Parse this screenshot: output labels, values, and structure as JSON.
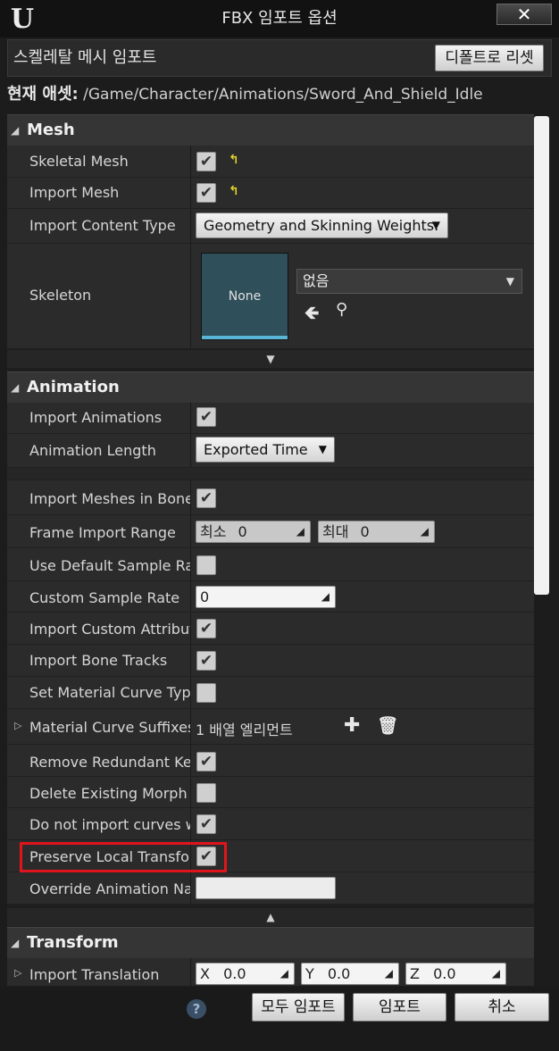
{
  "window": {
    "title": "FBX 임포트 옵션",
    "close_label": "✕",
    "logo": "U"
  },
  "topbar": {
    "label": "스켈레탈 메시 임포트",
    "reset_label": "디폴트로 리셋"
  },
  "asset": {
    "label": "현재 애셋:",
    "path": "/Game/Character/Animations/Sword_And_Shield_Idle"
  },
  "mesh": {
    "title": "Mesh",
    "skeletal_mesh_label": "Skeletal Mesh",
    "import_mesh_label": "Import Mesh",
    "import_content_type_label": "Import Content Type",
    "import_content_type_value": "Geometry and Skinning Weights.",
    "skeleton_label": "Skeleton",
    "skeleton_thumb": "None",
    "skeleton_value": "없음"
  },
  "animation": {
    "title": "Animation",
    "import_animations_label": "Import Animations",
    "animation_length_label": "Animation Length",
    "animation_length_value": "Exported Time",
    "import_meshes_in_bone_label": "Import Meshes in Bone",
    "frame_import_range_label": "Frame Import Range",
    "range_min_label": "최소",
    "range_min_value": "0",
    "range_max_label": "최대",
    "range_max_value": "0",
    "use_default_sample_rate_label": "Use Default Sample Rat",
    "custom_sample_rate_label": "Custom Sample Rate",
    "custom_sample_rate_value": "0",
    "import_custom_attribute_label": "Import Custom Attribute",
    "import_bone_tracks_label": "Import Bone Tracks",
    "set_material_curve_type_label": "Set Material Curve Type",
    "material_curve_suffixes_label": "Material Curve Suffixes",
    "material_curve_suffixes_value": "1 배열 엘리먼트",
    "remove_redundant_keys_label": "Remove Redundant Key",
    "delete_existing_morph_label": "Delete Existing Morph T",
    "do_not_import_curves_label": "Do not import curves wi",
    "preserve_local_transform_label": "Preserve Local Transfor",
    "override_animation_name_label": "Override Animation Nar"
  },
  "transform": {
    "title": "Transform",
    "import_translation_label": "Import Translation",
    "x_label": "X",
    "x_value": "0.0",
    "y_label": "Y",
    "y_value": "0.0",
    "z_label": "Z",
    "z_value": "0.0"
  },
  "footer": {
    "help": "?",
    "import_all_label": "모두 임포트",
    "import_label": "임포트",
    "cancel_label": "취소"
  },
  "colors": {
    "highlight": "#e0141c",
    "reset_arrow": "#e0d22a",
    "thumb_bar": "#5ab4d6"
  }
}
